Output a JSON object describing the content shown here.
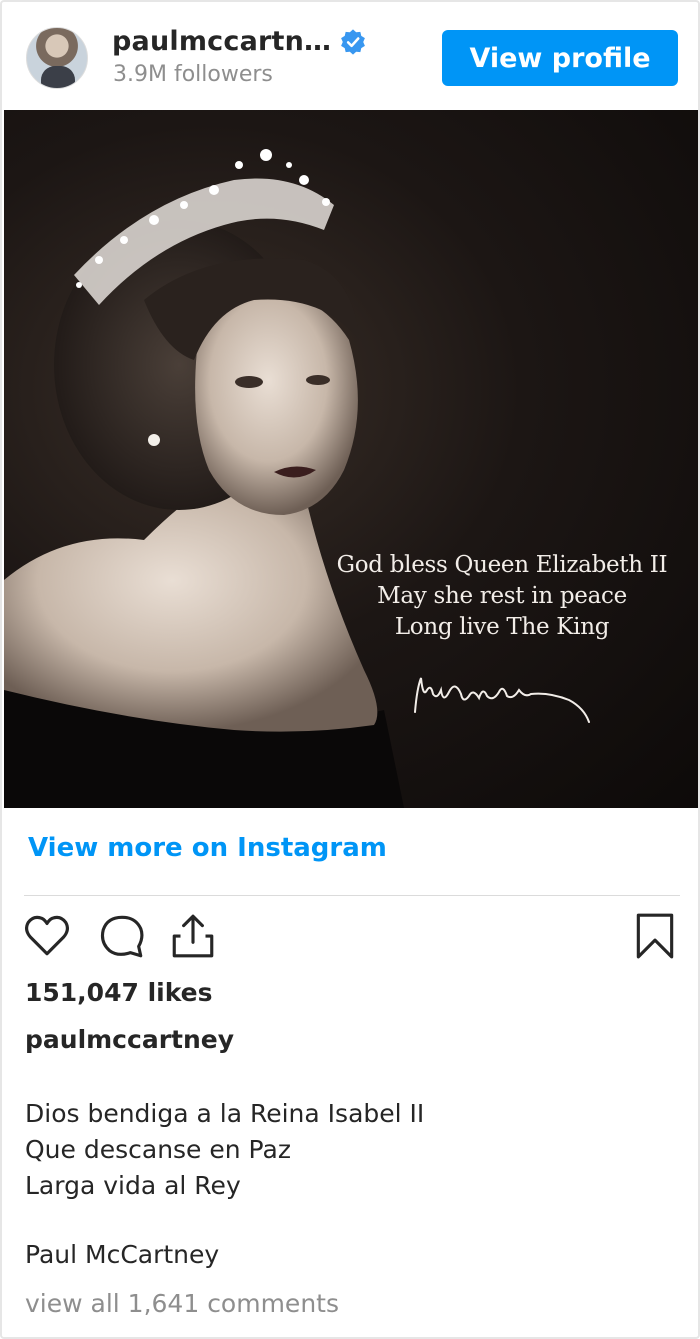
{
  "header": {
    "username": "paulmccartn…",
    "followers": "3.9M followers",
    "view_profile_label": "View profile",
    "verified_icon": "verified-badge-icon"
  },
  "post": {
    "image_caption_lines": [
      "God bless Queen Elizabeth II",
      "May she rest in peace",
      "Long live The King"
    ]
  },
  "view_more_label": "View more on Instagram",
  "actions": {
    "like_icon": "heart-icon",
    "comment_icon": "comment-icon",
    "share_icon": "share-icon",
    "save_icon": "bookmark-icon"
  },
  "likes": "151,047 likes",
  "owner": "paulmccartney",
  "caption_lines": [
    "Dios bendiga a la Reina Isabel II",
    "Que descanse en Paz",
    "Larga vida al Rey"
  ],
  "signoff": "Paul McCartney",
  "comments_link": "view all 1,641 comments",
  "colors": {
    "accent": "#0095f6",
    "text": "#262626",
    "muted": "#8e8e8e"
  }
}
